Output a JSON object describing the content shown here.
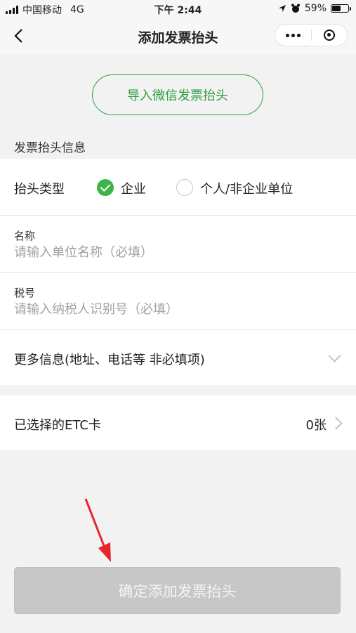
{
  "status_bar": {
    "carrier": "中国移动",
    "network": "4G",
    "time": "下午 2:44",
    "battery": "59%",
    "battery_level": 0.59
  },
  "nav": {
    "title": "添加发票抬头"
  },
  "import_button": "导入微信发票抬头",
  "section_label": "发票抬头信息",
  "header_type": {
    "label": "抬头类型",
    "options": [
      "企业",
      "个人/非企业单位"
    ],
    "selected": "企业"
  },
  "fields": {
    "name": {
      "label": "名称",
      "placeholder": "请输入单位名称（必填）"
    },
    "tax_id": {
      "label": "税号",
      "placeholder": "请输入纳税人识别号（必填）"
    }
  },
  "more_info": "更多信息(地址、电话等 非必填项)",
  "etc": {
    "label": "已选择的ETC卡",
    "count": "0张"
  },
  "confirm_button": "确定添加发票抬头",
  "colors": {
    "accent": "#3eb34a",
    "annotation_arrow": "#e8242c",
    "disabled_button": "#c7c7c7"
  }
}
